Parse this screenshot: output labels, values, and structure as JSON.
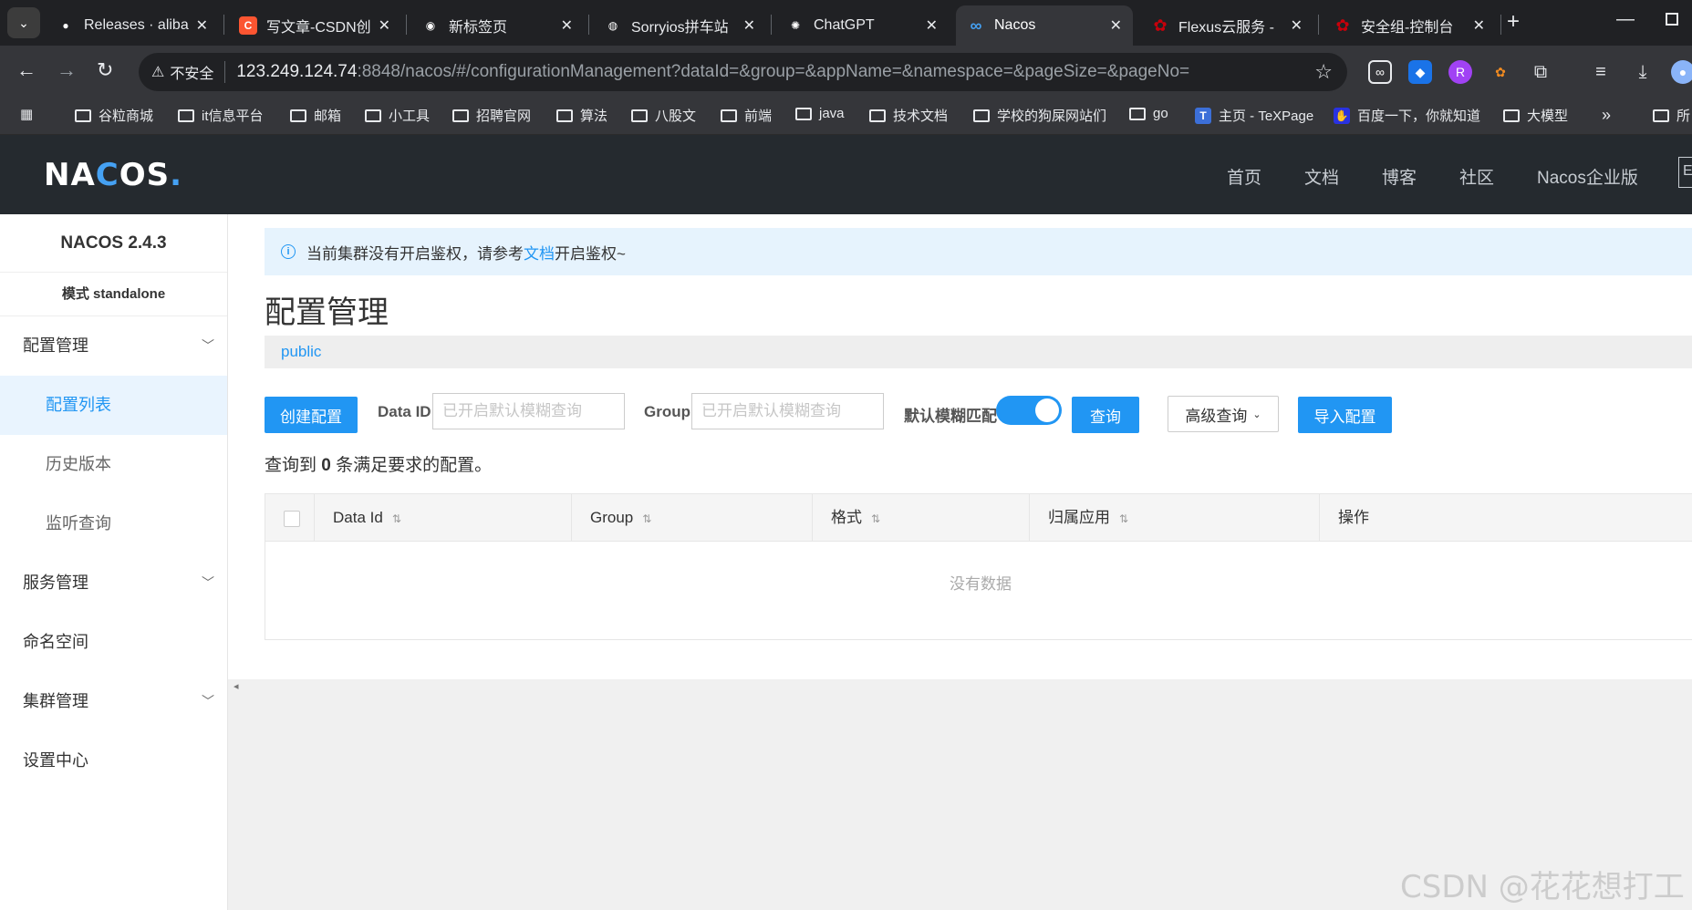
{
  "browser": {
    "tabs": [
      {
        "title": "Releases · aliba",
        "fav_color": "#3c3c3c",
        "fav_glyph": "●",
        "icon": "github-icon"
      },
      {
        "title": "写文章-CSDN创",
        "fav_color": "#fc5531",
        "fav_glyph": "C",
        "icon": "csdn-icon"
      },
      {
        "title": "新标签页",
        "fav_color": "#202124",
        "fav_glyph": "◉",
        "icon": "chrome-icon"
      },
      {
        "title": "Sorryios拼车站",
        "fav_color": "#202124",
        "fav_glyph": "◍",
        "icon": "globe-icon"
      },
      {
        "title": "ChatGPT",
        "fav_color": "#202124",
        "fav_glyph": "✺",
        "icon": "chatgpt-icon"
      },
      {
        "title": "Nacos",
        "fav_color": "#35363a",
        "fav_glyph": "∞",
        "icon": "nacos-icon"
      },
      {
        "title": "Flexus云服务 - ",
        "fav_color": "#c7000b",
        "fav_glyph": "✿",
        "icon": "huawei-icon"
      },
      {
        "title": "安全组-控制台",
        "fav_color": "#c7000b",
        "fav_glyph": "✿",
        "icon": "huawei-icon"
      }
    ],
    "address": {
      "security_label": "不安全",
      "url_host": "123.249.124.74",
      "url_rest": ":8848/nacos/#/configurationManagement?dataId=&group=&appName=&namespace=&pageSize=&pageNo="
    },
    "bookmarks": [
      {
        "label": "谷粒商城",
        "type": "folder"
      },
      {
        "label": "it信息平台",
        "type": "folder"
      },
      {
        "label": "邮箱",
        "type": "folder"
      },
      {
        "label": "小工具",
        "type": "folder"
      },
      {
        "label": "招聘官网",
        "type": "folder"
      },
      {
        "label": "算法",
        "type": "folder"
      },
      {
        "label": "八股文",
        "type": "folder"
      },
      {
        "label": "前端",
        "type": "folder"
      },
      {
        "label": "java",
        "type": "folder"
      },
      {
        "label": "技术文档",
        "type": "folder"
      },
      {
        "label": "学校的狗屎网站们",
        "type": "folder"
      },
      {
        "label": "go",
        "type": "folder"
      },
      {
        "label": "主页 - TeXPage",
        "type": "site"
      },
      {
        "label": "百度一下，你就知道",
        "type": "site"
      },
      {
        "label": "大模型",
        "type": "folder"
      },
      {
        "label": "所",
        "type": "folder"
      }
    ]
  },
  "header": {
    "logo_a": "NA",
    "logo_b": "C",
    "logo_c": "OS",
    "logo_dot": ".",
    "nav": [
      "首页",
      "文档",
      "博客",
      "社区",
      "Nacos企业版"
    ],
    "lang": "E"
  },
  "sidebar": {
    "version": "NACOS 2.4.3",
    "mode": "模式 standalone",
    "config_mgmt": "配置管理",
    "config_list": "配置列表",
    "history": "历史版本",
    "listen_query": "监听查询",
    "service_mgmt": "服务管理",
    "namespace": "命名空间",
    "cluster_mgmt": "集群管理",
    "settings": "设置中心"
  },
  "main": {
    "alert_prefix": "当前集群没有开启鉴权，请参考",
    "alert_link": "文档",
    "alert_suffix": "开启鉴权~",
    "title": "配置管理",
    "namespace": "public",
    "create_btn": "创建配置",
    "dataid_label": "Data ID",
    "dataid_placeholder": "已开启默认模糊查询",
    "group_label": "Group",
    "group_placeholder": "已开启默认模糊查询",
    "fuzzy_label": "默认模糊匹配",
    "fuzzy_on": true,
    "query_btn": "查询",
    "advanced_btn": "高级查询",
    "import_btn": "导入配置",
    "result_prefix": "查询到",
    "result_count": "0",
    "result_suffix": "条满足要求的配置。",
    "columns": [
      "Data Id",
      "Group",
      "格式",
      "归属应用",
      "操作"
    ],
    "empty_text": "没有数据"
  },
  "watermark": "CSDN @花花想打工"
}
